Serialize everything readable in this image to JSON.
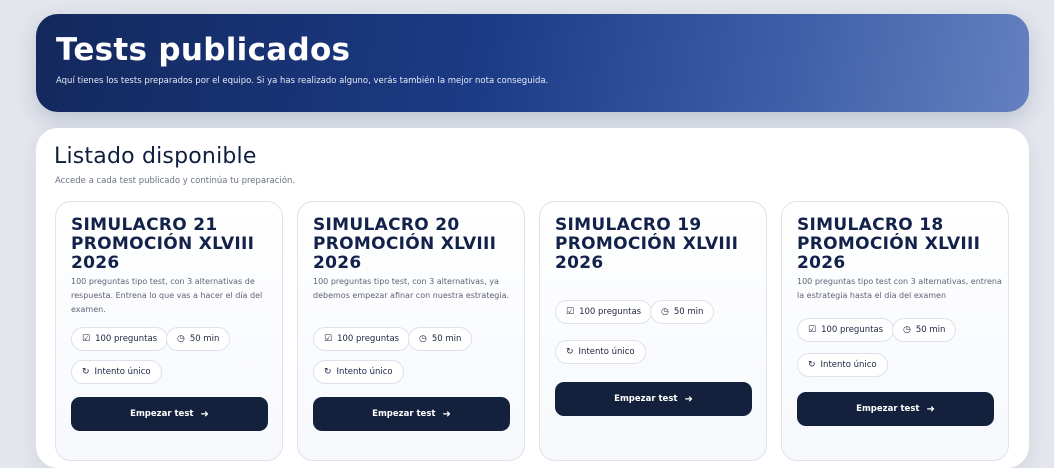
{
  "hero": {
    "title": "Tests publicados",
    "subtitle": "Aquí tienes los tests preparados por el equipo. Si ya has realizado alguno, verás también la mejor nota conseguida."
  },
  "list": {
    "title": "Listado disponible",
    "subtitle": "Accede a cada test publicado y continúa tu preparación."
  },
  "icons": {
    "questions": "checkbox-icon",
    "time": "clock-icon",
    "attempt": "refresh-icon",
    "arrow": "arrow-right-icon"
  },
  "colors": {
    "hero_start": "#13285c",
    "hero_end": "#6480bf",
    "button": "#13213d",
    "title": "#12224a"
  },
  "cards": [
    {
      "title": "SIMULACRO 21 PROMOCIÓN XLVIII 2026",
      "description": "100 preguntas tipo test, con 3 alternativas de respuesta. Entrena lo que vas a hacer el día del examen.",
      "questions": "100 preguntas",
      "duration": "50 min",
      "attempt": "Intento único",
      "button": "Empezar test"
    },
    {
      "title": "SIMULACRO 20 PROMOCIÓN XLVIII 2026",
      "description": "100 preguntas tipo test, con 3 alternativas, ya debemos empezar afinar con nuestra estrategia.",
      "questions": "100 preguntas",
      "duration": "50 min",
      "attempt": "Intento único",
      "button": "Empezar test"
    },
    {
      "title": "SIMULACRO 19 PROMOCIÓN XLVIII 2026",
      "description": "",
      "questions": "100 preguntas",
      "duration": "50 min",
      "attempt": "Intento único",
      "button": "Empezar test"
    },
    {
      "title": "SIMULACRO 18 PROMOCIÓN XLVIII 2026",
      "description": "100 preguntas tipo test con 3 alternativas, entrena la estrategia hasta el día del examen",
      "questions": "100 preguntas",
      "duration": "50 min",
      "attempt": "Intento único",
      "button": "Empezar test"
    }
  ]
}
